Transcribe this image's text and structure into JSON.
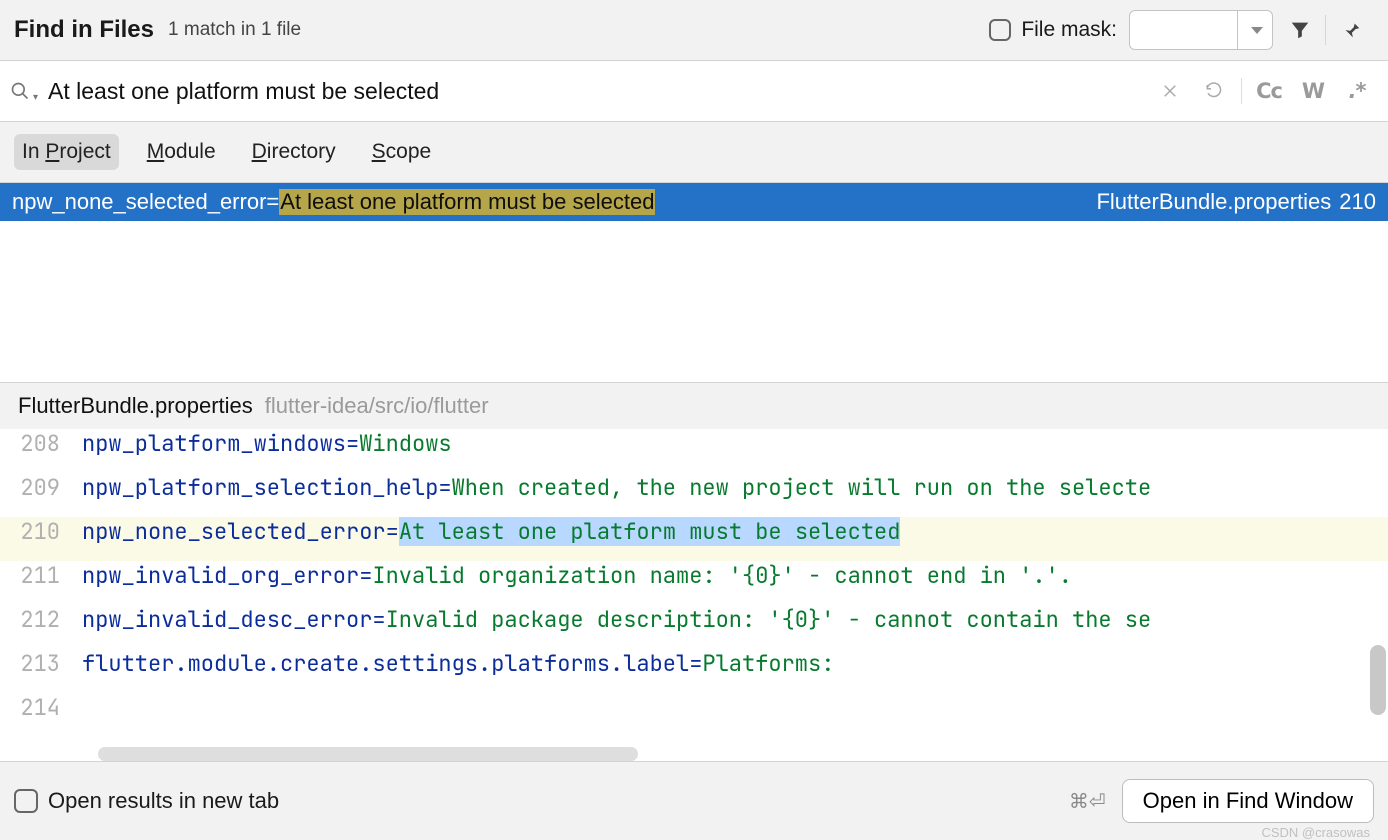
{
  "header": {
    "title": "Find in Files",
    "subtitle": "1 match in 1 file",
    "fileMaskLabel": "File mask:"
  },
  "search": {
    "query": "At least one platform must be selected",
    "ccLabel": "Cc",
    "wLabel": "W",
    "regexLabel": ".*"
  },
  "scope": {
    "inProject": "In Project",
    "module": "Module",
    "directory": "Directory",
    "scope": "Scope"
  },
  "result": {
    "key": "npw_none_selected_error",
    "eq": "=",
    "match": "At least one platform must be selected",
    "file": "FlutterBundle.properties",
    "line": "210"
  },
  "preview": {
    "fileName": "FlutterBundle.properties",
    "path": "flutter-idea/src/io/flutter"
  },
  "code": {
    "lines": [
      {
        "num": "208",
        "key": "npw_platform_windows",
        "val": "Windows",
        "hl": false,
        "sel": false
      },
      {
        "num": "209",
        "key": "npw_platform_selection_help",
        "val": "When created, the new project will run on the selecte",
        "hl": false,
        "sel": false
      },
      {
        "num": "210",
        "key": "npw_none_selected_error",
        "val": "At least one platform must be selected",
        "hl": true,
        "sel": true
      },
      {
        "num": "211",
        "key": "npw_invalid_org_error",
        "val": "Invalid organization name: '{0}' - cannot end in '.'.",
        "hl": false,
        "sel": false
      },
      {
        "num": "212",
        "key": "npw_invalid_desc_error",
        "val": "Invalid package description: '{0}' - cannot contain the se",
        "hl": false,
        "sel": false
      },
      {
        "num": "213",
        "key": "flutter.module.create.settings.platforms.label",
        "val": "Platforms:",
        "hl": false,
        "sel": false
      },
      {
        "num": "214",
        "key": "",
        "val": "",
        "hl": false,
        "sel": false
      }
    ]
  },
  "footer": {
    "openNewTab": "Open results in new tab",
    "shortcut": "⌘⏎",
    "openFindWindow": "Open in Find Window"
  },
  "watermark": "CSDN @crasowas"
}
